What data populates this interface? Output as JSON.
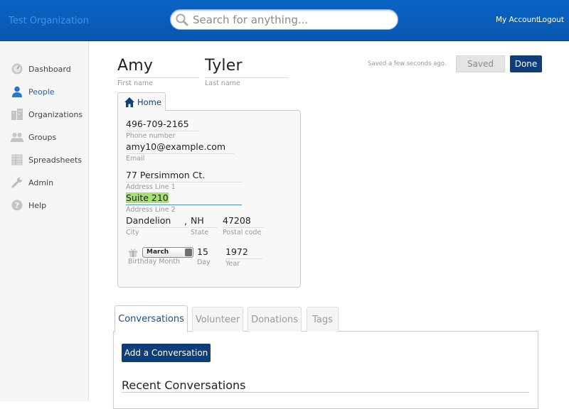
{
  "header": {
    "org_name": "Test Organization",
    "search_placeholder": "Search for anything...",
    "my_account": "My Account",
    "logout": "Logout"
  },
  "sidebar": {
    "items": [
      {
        "label": "Dashboard",
        "icon": "dashboard-icon"
      },
      {
        "label": "People",
        "icon": "person-icon",
        "active": true
      },
      {
        "label": "Organizations",
        "icon": "buildings-icon"
      },
      {
        "label": "Groups",
        "icon": "group-icon"
      },
      {
        "label": "Spreadsheets",
        "icon": "spreadsheet-icon"
      },
      {
        "label": "Admin",
        "icon": "wrench-icon"
      },
      {
        "label": "Help",
        "icon": "help-icon"
      }
    ]
  },
  "person": {
    "first_name": "Amy",
    "first_name_label": "First name",
    "last_name": "Tyler",
    "last_name_label": "Last name"
  },
  "status": {
    "saved_text": "Saved a few seconds ago.",
    "saved_button": "Saved",
    "done_button": "Done"
  },
  "home_tab": {
    "label": "Home",
    "phone": "496-709-2165",
    "phone_label": "Phone number",
    "email": "amy10@example.com",
    "email_label": "Email",
    "address1": "77 Persimmon Ct.",
    "address1_label": "Address Line 1",
    "address2": "Suite 210",
    "address2_label": "Address Line 2",
    "city": "Dandelion",
    "city_label": "City",
    "state": "NH",
    "state_label": "State",
    "postal": "47208",
    "postal_label": "Postal code",
    "comma": ",",
    "birthday_month": "March",
    "birthday_month_label": "Birthday Month",
    "day": "15",
    "day_label": "Day",
    "year": "1972",
    "year_label": "Year"
  },
  "tabs": [
    {
      "label": "Conversations",
      "active": true
    },
    {
      "label": "Volunteer"
    },
    {
      "label": "Donations"
    },
    {
      "label": "Tags"
    }
  ],
  "conversations": {
    "add_button": "Add a Conversation",
    "recent_title": "Recent Conversations"
  },
  "colors": {
    "topbar": "#0a5fbd",
    "primary_button": "#0d3e7a",
    "highlight": "#a7e26e",
    "active_nav": "#1a64b8"
  }
}
